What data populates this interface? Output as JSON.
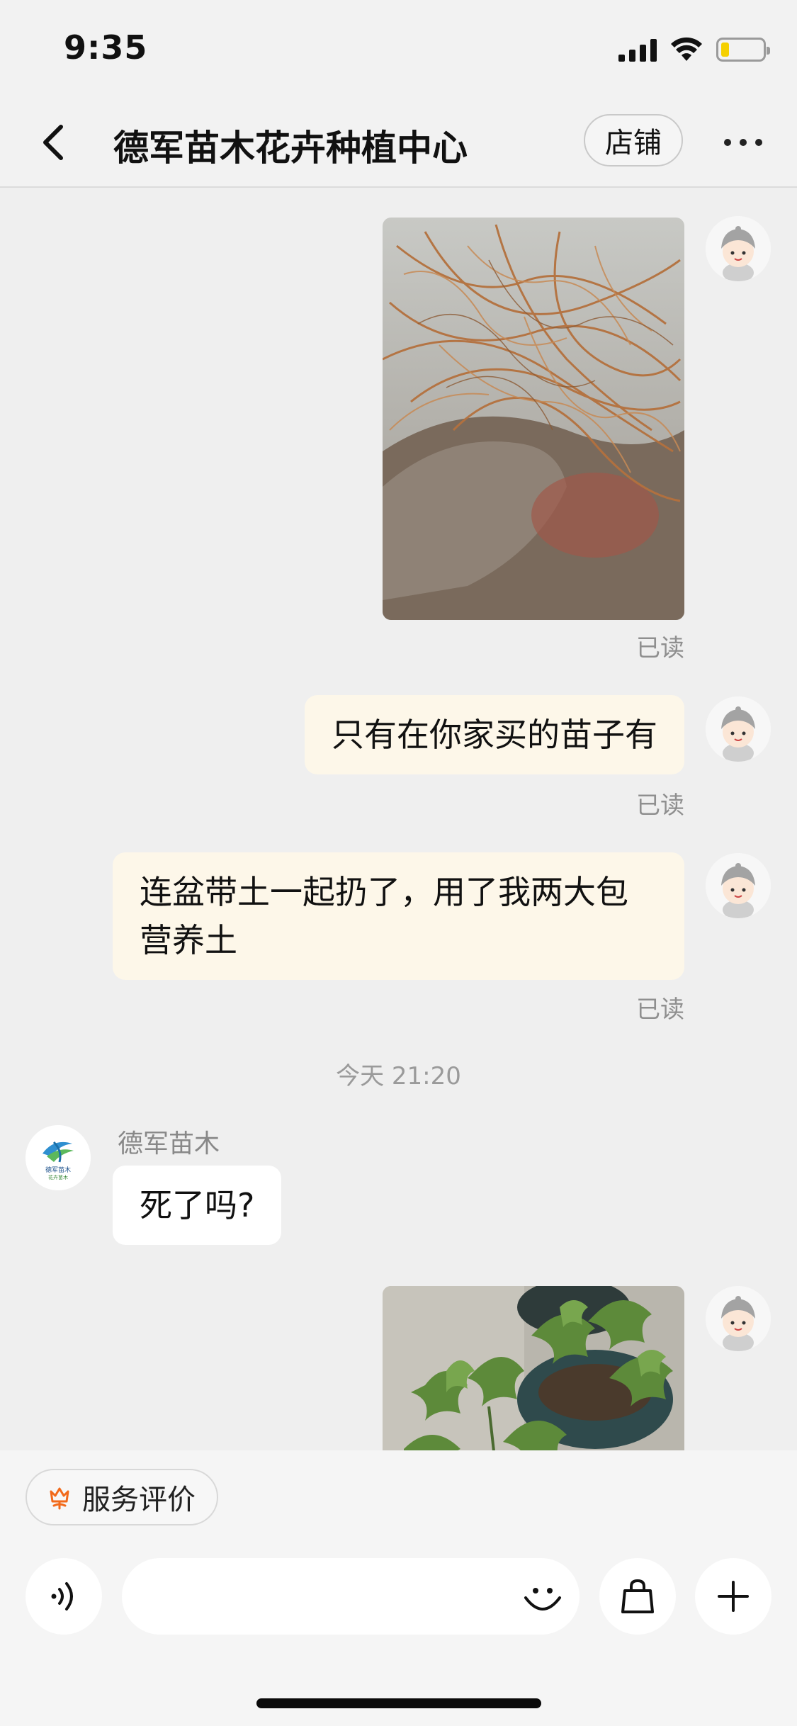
{
  "status_bar": {
    "time": "9:35",
    "battery_level": 0.2
  },
  "header": {
    "title": "德军苗木花卉种植中心",
    "store_button": "店铺",
    "back_icon": "chevron-left-icon",
    "more_icon": "more-horizontal-icon"
  },
  "messages": [
    {
      "type": "image",
      "from": "me",
      "image": "plant-roots-photo",
      "read_status": "已读"
    },
    {
      "type": "text",
      "from": "me",
      "text": "只有在你家买的苗子有",
      "read_status": "已读"
    },
    {
      "type": "text",
      "from": "me",
      "text": "连盆带土一起扔了，用了我两大包\n营养土",
      "read_status": "已读"
    },
    {
      "type": "timestamp",
      "text": "今天 21:20"
    },
    {
      "type": "text",
      "from": "shop",
      "sender": "德军苗木",
      "text": "死了吗?"
    },
    {
      "type": "image",
      "from": "me",
      "image": "potted-fig-plants-photo"
    }
  ],
  "shop_logo_text": [
    "德军苗木",
    "花卉苗木"
  ],
  "bottom": {
    "service_button": "服务评价",
    "service_icon": "flower-icon",
    "voice_icon": "voice-icon",
    "emoji_icon": "smile-icon",
    "shop_icon": "shopping-bag-icon",
    "add_icon": "plus-icon",
    "input_value": ""
  },
  "colors": {
    "my_bubble": "#fdf7e9",
    "their_bubble": "#ffffff",
    "background": "#efefef",
    "service_icon": "#f26a1b"
  }
}
